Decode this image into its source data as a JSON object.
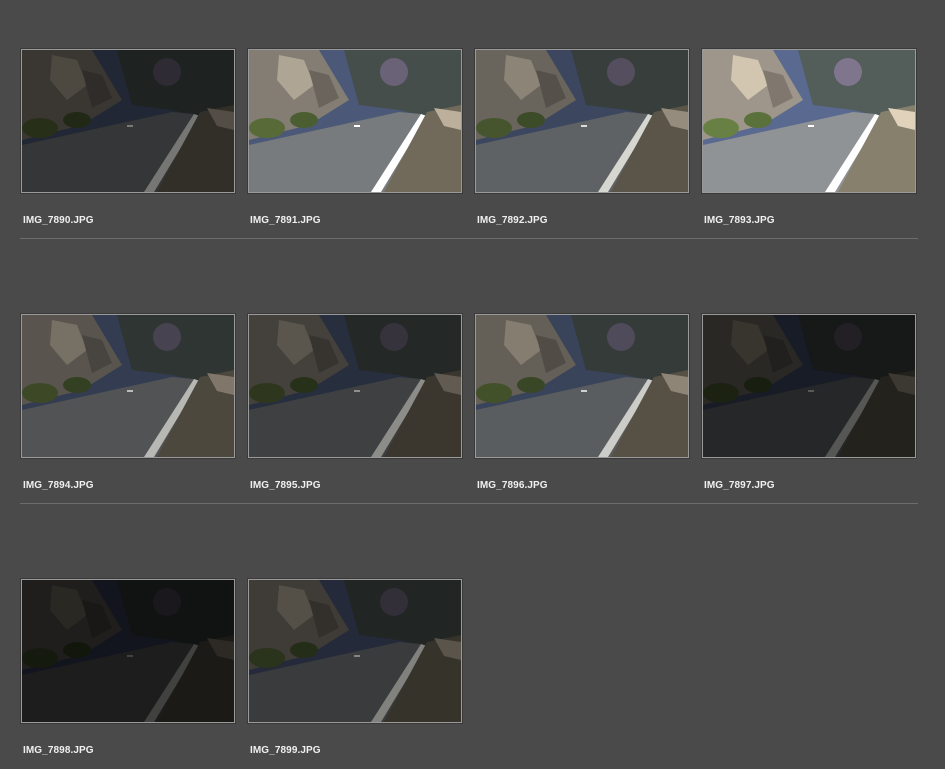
{
  "browser": {
    "items": [
      {
        "filename": "IMG_7890.JPG",
        "exposure": 0.55
      },
      {
        "filename": "IMG_7891.JPG",
        "exposure": 1.25
      },
      {
        "filename": "IMG_7892.JPG",
        "exposure": 1.0
      },
      {
        "filename": "IMG_7893.JPG",
        "exposure": 1.5
      },
      {
        "filename": "IMG_7894.JPG",
        "exposure": 0.85
      },
      {
        "filename": "IMG_7895.JPG",
        "exposure": 0.65
      },
      {
        "filename": "IMG_7896.JPG",
        "exposure": 0.95
      },
      {
        "filename": "IMG_7897.JPG",
        "exposure": 0.4
      },
      {
        "filename": "IMG_7898.JPG",
        "exposure": 0.3
      },
      {
        "filename": "IMG_7899.JPG",
        "exposure": 0.6
      }
    ]
  },
  "colors": {
    "background": "#4a4a4a",
    "separator": "#6c6c6c",
    "thumb_border": "#9a9a9a",
    "label": "#f0f0f0"
  }
}
